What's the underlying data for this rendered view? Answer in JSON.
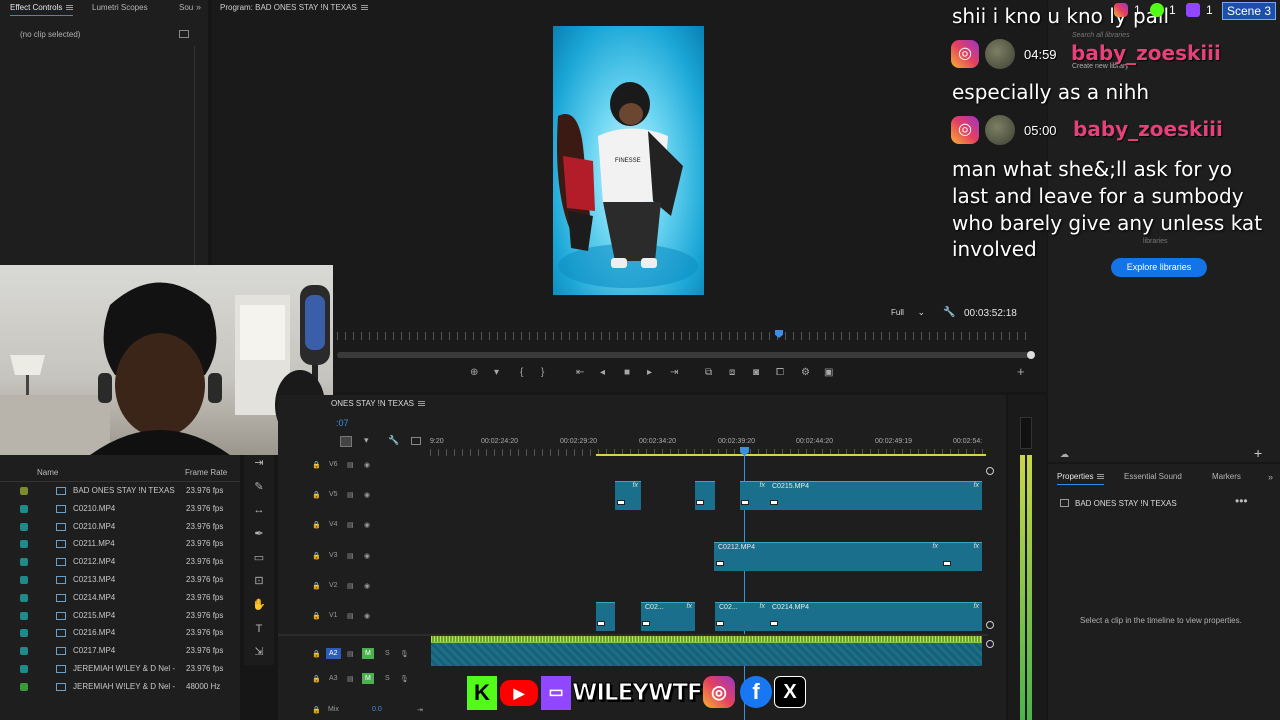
{
  "effect_controls": {
    "tab_effect_controls": "Effect Controls",
    "tab_lumetri": "Lumetri Scopes",
    "tab_source": "Sou",
    "no_clip": "(no clip selected)"
  },
  "program": {
    "title": "Program: BAD ONES STAY !N TEXAS",
    "fit": "Full",
    "timecode": "00:03:52:18",
    "video_shirt_text": "FINESSE"
  },
  "library": {
    "search_placeholder": "Search all libraries",
    "create_new": "Create new library",
    "libraries": "libraries",
    "explore_button": "Explore libraries"
  },
  "properties": {
    "tab_properties": "Properties",
    "tab_essential_sound": "Essential Sound",
    "tab_markers": "Markers",
    "sequence_name": "BAD ONES STAY !N TEXAS",
    "hint": "Select a clip in the timeline to view properties."
  },
  "timeline": {
    "sequence_tab": "ONES STAY !N TEXAS",
    "current_time": ":07",
    "ruler": [
      "9:20",
      "00:02:24:20",
      "00:02:29:20",
      "00:02:34:20",
      "00:02:39:20",
      "00:02:44:20",
      "00:02:49:19",
      "00:02:54:"
    ],
    "tracks": {
      "v6": "V6",
      "v5": "V5",
      "v4": "V4",
      "v3": "V3",
      "v2": "V2",
      "v1": "V1",
      "a2": "A2",
      "a3": "A3",
      "mix": "Mix",
      "mix_value": "0.0",
      "mute": "M",
      "solo": "S"
    },
    "clips": {
      "c0215": "C0215.MP4",
      "c0212": "C0212.MP4",
      "c02a": "C02...",
      "c02b": "C02...",
      "c0214": "C0214.MP4",
      "fx": "fx"
    }
  },
  "project": {
    "col_name": "Name",
    "col_frame_rate": "Frame Rate",
    "items": [
      {
        "name": "BAD ONES STAY !N TEXAS",
        "fps": "23.976 fps",
        "color": "#7a8c2e"
      },
      {
        "name": "C0210.MP4",
        "fps": "23.976 fps",
        "color": "#1f8a8a"
      },
      {
        "name": "C0210.MP4",
        "fps": "23.976 fps",
        "color": "#1f8a8a"
      },
      {
        "name": "C0211.MP4",
        "fps": "23.976 fps",
        "color": "#1f8a8a"
      },
      {
        "name": "C0212.MP4",
        "fps": "23.976 fps",
        "color": "#1f8a8a"
      },
      {
        "name": "C0213.MP4",
        "fps": "23.976 fps",
        "color": "#1f8a8a"
      },
      {
        "name": "C0214.MP4",
        "fps": "23.976 fps",
        "color": "#1f8a8a"
      },
      {
        "name": "C0215.MP4",
        "fps": "23.976 fps",
        "color": "#1f8a8a"
      },
      {
        "name": "C0216.MP4",
        "fps": "23.976 fps",
        "color": "#1f8a8a"
      },
      {
        "name": "C0217.MP4",
        "fps": "23.976 fps",
        "color": "#1f8a8a"
      },
      {
        "name": "JEREMIAH W!LEY & D Nel -",
        "fps": "23.976 fps",
        "color": "#1f8a8a"
      },
      {
        "name": "JEREMIAH W!LEY & D Nel -",
        "fps": "48000 Hz",
        "color": "#3a9a3a"
      }
    ]
  },
  "chat": {
    "msg0": "shii i kno u kno ly pall",
    "msg1_time": "04:59",
    "msg1_user": "baby_zoeskiii",
    "msg1_text": "especially as a nihh",
    "msg2_time": "05:00",
    "msg2_user": "baby_zoeskiii",
    "msg2_lines": [
      "man what she&;ll ask for yo",
      "last and leave for a sumbody",
      "who barely give any unless kat",
      "involved"
    ]
  },
  "stream_overlay": {
    "ig_count": "1",
    "kick_count": "1",
    "twitch_count": "1",
    "scene": "Scene 3",
    "handle": "WILEYWTF"
  }
}
